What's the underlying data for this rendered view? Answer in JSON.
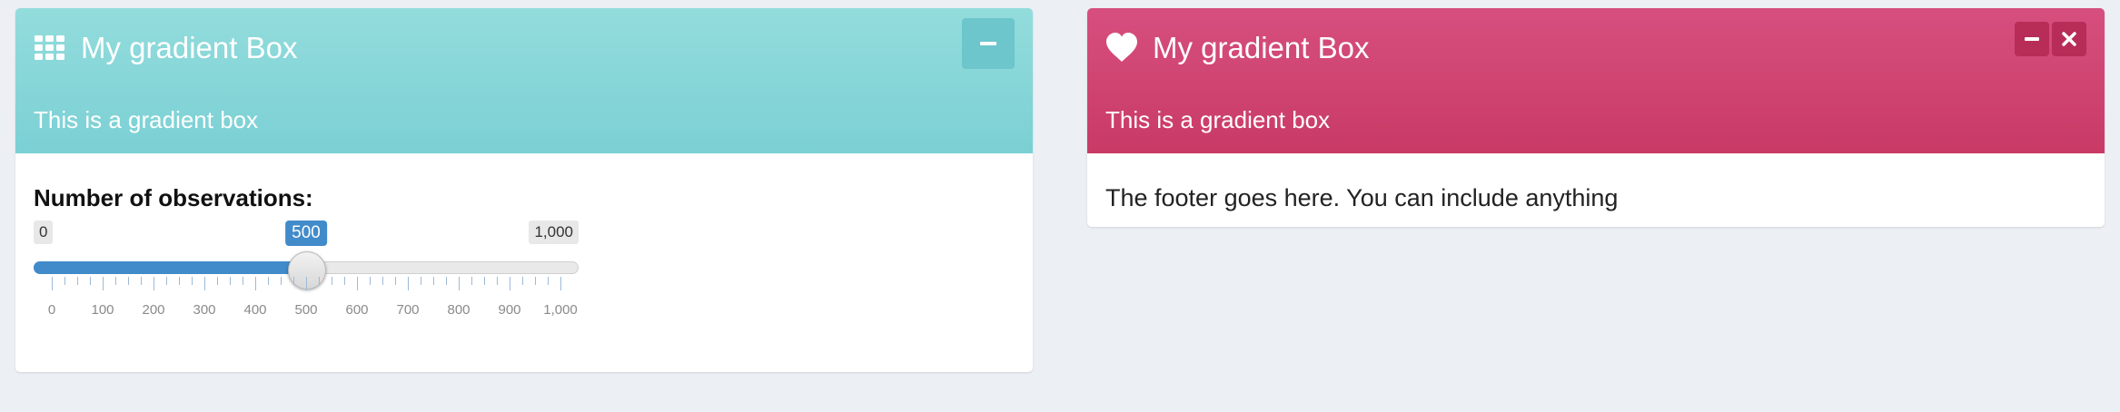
{
  "colors": {
    "teal": "#7bd0d4",
    "maroon": "#d64f7e",
    "slider_accent": "#428bca",
    "background": "#ecf0f5"
  },
  "box_left": {
    "title": "My gradient Box",
    "icon": "th-grid-icon",
    "subtitle": "This is a gradient box",
    "tools": [
      "collapse-button"
    ],
    "slider": {
      "label": "Number of observations:",
      "min": 0,
      "max": 1000,
      "value": 500,
      "min_label": "0",
      "max_label": "1,000",
      "value_label": "500",
      "tick_labels": [
        "0",
        "100",
        "200",
        "300",
        "400",
        "500",
        "600",
        "700",
        "800",
        "900",
        "1,000"
      ]
    }
  },
  "box_right": {
    "title": "My gradient Box",
    "icon": "heart-icon",
    "subtitle": "This is a gradient box",
    "tools": [
      "collapse-button",
      "remove-button"
    ],
    "footer_text": "The footer goes here. You can include anything"
  }
}
